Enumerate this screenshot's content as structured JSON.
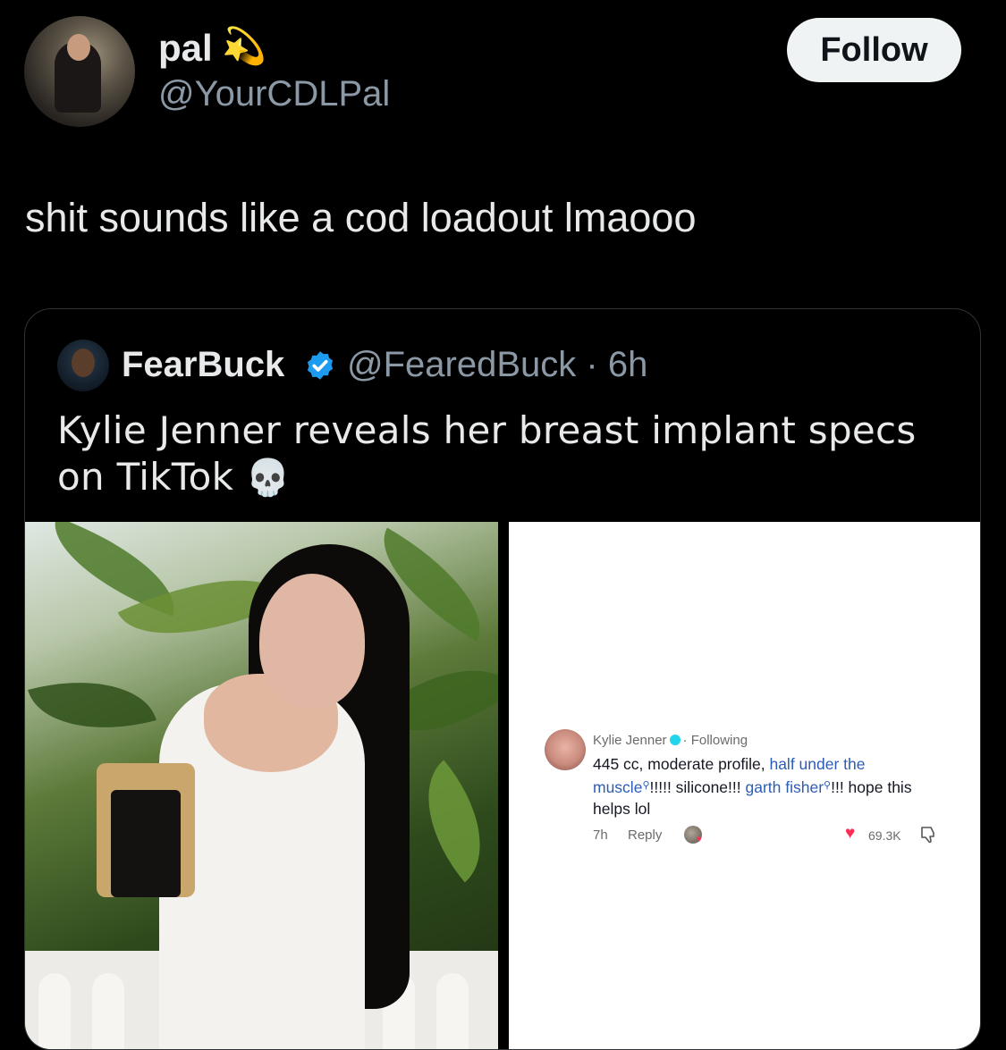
{
  "tweet": {
    "display_name": "pal",
    "name_emoji": "💫",
    "handle": "@YourCDLPal",
    "follow_label": "Follow",
    "text": "shit sounds like a cod loadout lmaooo"
  },
  "quote": {
    "display_name": "FearBuck",
    "handle_time": "@FearedBuck · 6h",
    "text": "Kylie Jenner reveals her breast implant specs on TikTok",
    "emoji": "💀"
  },
  "tiktok_comment": {
    "author": "Kylie Jenner",
    "following_label": "· Following",
    "text_part1": "445 cc, moderate profile, ",
    "link1": "half under the muscle",
    "text_part2": "!!!!! silicone!!! ",
    "link2": "garth fisher",
    "text_part3": "!!! hope this helps lol",
    "time": "7h",
    "reply_label": "Reply",
    "likes": "69.3K"
  },
  "colors": {
    "background": "#000000",
    "follow_bg": "#eff3f4",
    "verified_blue": "#1d9bf0",
    "tiktok_link": "#2b5db6",
    "tiktok_heart": "#fe2c55"
  }
}
